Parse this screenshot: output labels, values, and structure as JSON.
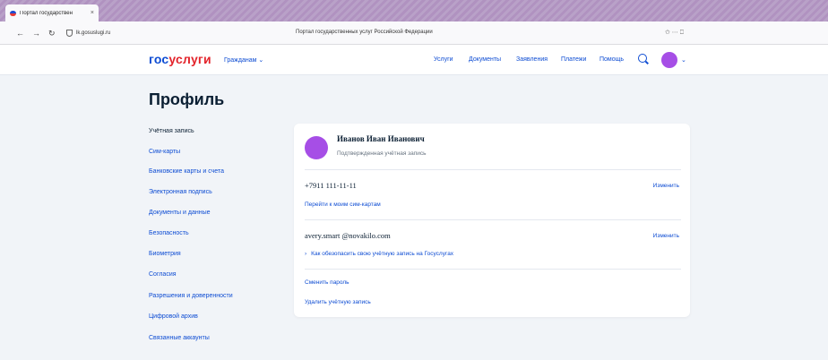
{
  "browser": {
    "tab_title": "Портал государствен",
    "tab_close": "×",
    "url": "lk.gosuslugi.ru",
    "window_title": "Портал государственных услуг Российской Федерации",
    "back": "←",
    "forward": "→",
    "reload": "↻",
    "right_icons": "✩ ⋯ ⎕"
  },
  "header": {
    "logo_part1": "гос",
    "logo_part2": "услуги",
    "citizens_label": "Гражданам ⌄",
    "nav": [
      "Услуги",
      "Документы",
      "Заявления",
      "Платежи",
      "Помощь"
    ],
    "user_chevron": "⌄"
  },
  "page": {
    "title": "Профиль"
  },
  "sidebar": {
    "items": [
      "Учётная запись",
      "Сим-карты",
      "Банковские карты и счета",
      "Электронная подпись",
      "Документы и данные",
      "Безопасность",
      "Биометрия",
      "Согласия",
      "Разрешения и доверенности",
      "Цифровой архив",
      "Связанные аккаунты"
    ]
  },
  "card": {
    "full_name": "Иванов Иван Иванович",
    "verified": "Подтвержденная учётная запись",
    "phone": "+7911 111-11-11",
    "phone_edit": "Изменить",
    "sim_link": "Перейти к моим сим-картам",
    "email": "avery.smart @novakilo.com",
    "email_edit": "Изменить",
    "secure_chevron": "›",
    "secure_link": "Как обезопасить свою учётную запись на Госуслугах",
    "change_password": "Сменить пароль",
    "delete_account": "Удалить учётную запись"
  }
}
